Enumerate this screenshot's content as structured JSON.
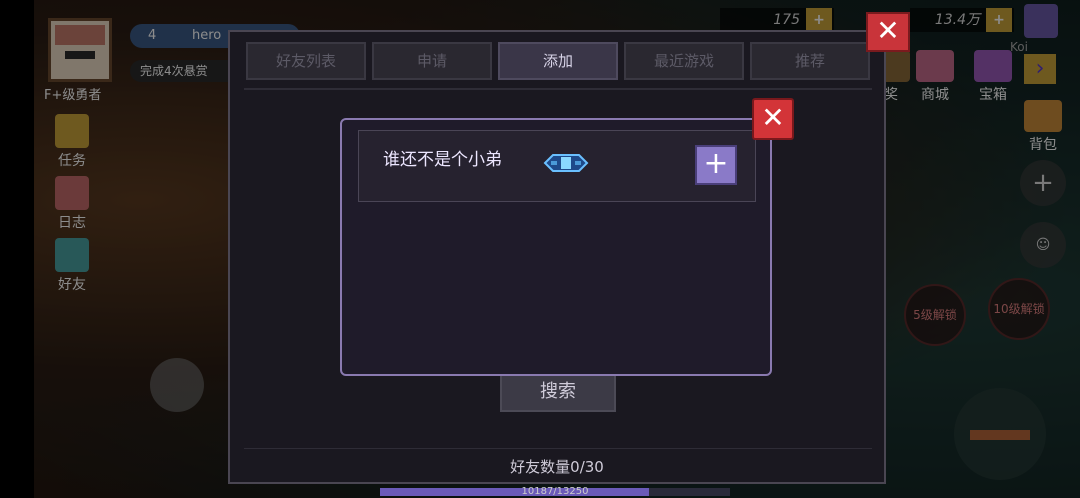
{
  "hud": {
    "rank": "F+级勇者",
    "level": "4",
    "player_name": "hero",
    "quest_text": "完成4次悬赏",
    "gems": "175",
    "gold": "13.4万",
    "plus": "+",
    "left_menu": [
      {
        "label": "任务",
        "icon": "quest-scroll-icon"
      },
      {
        "label": "日志",
        "icon": "log-book-icon"
      },
      {
        "label": "好友",
        "icon": "friend-icon"
      }
    ],
    "right_menu": [
      {
        "label": "奖",
        "icon": "reward-icon"
      },
      {
        "label": "商城",
        "icon": "shop-icon"
      },
      {
        "label": "宝箱",
        "icon": "chest-icon"
      },
      {
        "label": "背包",
        "icon": "backpack-icon"
      }
    ],
    "top_right_name": "Koi",
    "unlock5": "5级解锁",
    "unlock10": "10级解锁",
    "exp_text": "10187/13250",
    "exp_fraction": 0.769
  },
  "friends_panel": {
    "tabs": [
      "好友列表",
      "申请",
      "添加",
      "最近游戏",
      "推荐"
    ],
    "active_tab": "添加",
    "search_label": "搜索",
    "friend_count": "好友数量0/30",
    "close_label": "✕"
  },
  "add_popup": {
    "result_name": "谁还不是个小弟",
    "add_label": "+",
    "close_label": "✕"
  },
  "colors": {
    "accent": "#8a7ac8",
    "close_red": "#d33438",
    "panel_bg": "#1a1820"
  }
}
